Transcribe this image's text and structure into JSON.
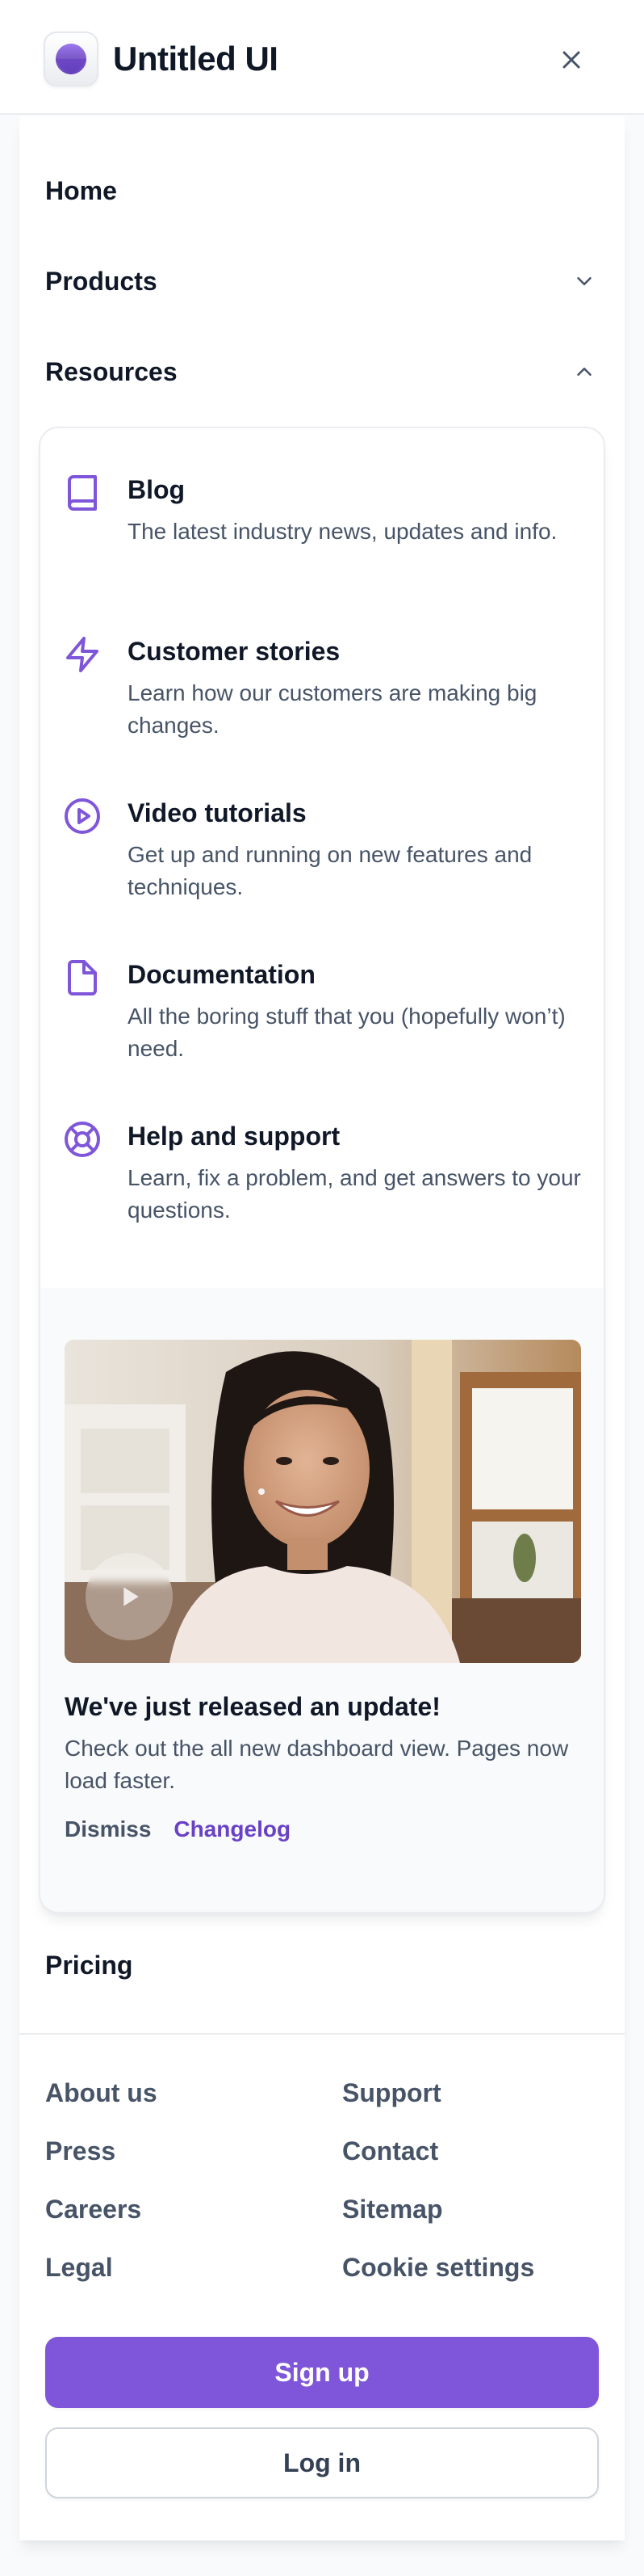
{
  "header": {
    "brand": "Untitled UI",
    "logo_icon": "logo-mark",
    "close_icon": "close-icon"
  },
  "nav": {
    "home": "Home",
    "products": "Products",
    "resources": "Resources",
    "pricing": "Pricing"
  },
  "resources": {
    "items": [
      {
        "icon": "book-icon",
        "title": "Blog",
        "description": "The latest industry news, updates and info."
      },
      {
        "icon": "lightning-icon",
        "title": "Customer stories",
        "description": "Learn how our customers are making big changes."
      },
      {
        "icon": "play-circle-icon",
        "title": "Video tutorials",
        "description": "Get up and running on new features and techniques."
      },
      {
        "icon": "file-icon",
        "title": "Documentation",
        "description": "All the boring stuff that you (hopefully won’t) need."
      },
      {
        "icon": "life-buoy-icon",
        "title": "Help and support",
        "description": "Learn, fix a problem, and get answers to your questions."
      }
    ],
    "featured": {
      "title": "We've just released an update!",
      "description": "Check out the all new dashboard view. Pages now load faster.",
      "dismiss": "Dismiss",
      "changelog": "Changelog"
    }
  },
  "footer": {
    "left": [
      "About us",
      "Press",
      "Careers",
      "Legal"
    ],
    "right": [
      "Support",
      "Contact",
      "Sitemap",
      "Cookie settings"
    ]
  },
  "actions": {
    "sign_up": "Sign up",
    "log_in": "Log in"
  },
  "colors": {
    "brand": "#7f56d9",
    "brand_text": "#6941c6",
    "heading": "#101828",
    "body": "#475467"
  }
}
